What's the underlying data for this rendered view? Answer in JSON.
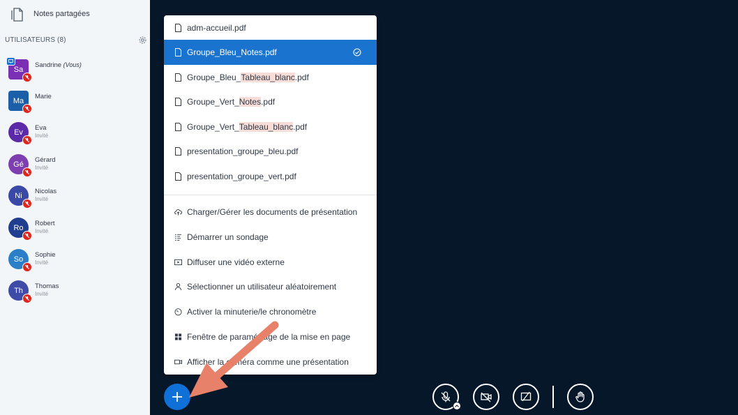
{
  "sidebar": {
    "notes_label": "Notes partagées",
    "users_header": "UTILISATEURS (8)",
    "users": [
      {
        "initials": "Sa",
        "name": "Sandrine",
        "you_tag": "(Vous)",
        "role": "",
        "color": "#7b2fb5"
      },
      {
        "initials": "Ma",
        "name": "Marie",
        "you_tag": "",
        "role": "",
        "color": "#1b5fa8"
      },
      {
        "initials": "Ev",
        "name": "Eva",
        "you_tag": "",
        "role": "Invité",
        "color": "#5b2aa8"
      },
      {
        "initials": "Gé",
        "name": "Gérard",
        "you_tag": "",
        "role": "Invité",
        "color": "#7d3fb0"
      },
      {
        "initials": "Ni",
        "name": "Nicolas",
        "you_tag": "",
        "role": "Invité",
        "color": "#3a49a8"
      },
      {
        "initials": "Ro",
        "name": "Robert",
        "you_tag": "",
        "role": "Invité",
        "color": "#203e8f"
      },
      {
        "initials": "So",
        "name": "Sophie",
        "you_tag": "",
        "role": "Invité",
        "color": "#2a7fc8"
      },
      {
        "initials": "Th",
        "name": "Thomas",
        "you_tag": "",
        "role": "Invité",
        "color": "#3f4ba8"
      }
    ]
  },
  "menu": {
    "files": [
      {
        "label": "adm-accueil.pdf"
      },
      {
        "label": "Groupe_Bleu_Notes.pdf",
        "active": true
      },
      {
        "label_parts": [
          "Groupe_Bleu_",
          "Tableau_blanc",
          ".pdf"
        ]
      },
      {
        "label_parts": [
          "Groupe_Vert_",
          "Notes",
          ".pdf"
        ]
      },
      {
        "label_parts": [
          "Groupe_Vert_",
          "Tableau_blanc",
          ".pdf"
        ]
      },
      {
        "label": "presentation_groupe_bleu.pdf"
      },
      {
        "label": "presentation_groupe_vert.pdf"
      }
    ],
    "actions": [
      {
        "label": "Charger/Gérer les documents de présentation",
        "icon": "upload-cloud-icon"
      },
      {
        "label": "Démarrer un sondage",
        "icon": "poll-icon"
      },
      {
        "label": "Diffuser une vidéo externe",
        "icon": "external-video-icon"
      },
      {
        "label": "Sélectionner un utilisateur aléatoirement",
        "icon": "random-user-icon"
      },
      {
        "label": "Activer la minuterie/le chronomètre",
        "icon": "timer-icon"
      },
      {
        "label_parts": [
          "Fenêtre de paramé",
          "tr",
          "age de la mise en page"
        ],
        "icon": "layout-icon"
      },
      {
        "label_parts": [
          "Afficher la",
          " ca",
          "méra comme une présentation"
        ],
        "icon": "camera-icon"
      }
    ]
  },
  "controls": {
    "actions_button": "plus-icon",
    "buttons": [
      "mic-muted-icon",
      "camera-off-icon",
      "screenshare-off-icon",
      "raise-hand-icon"
    ]
  },
  "colors": {
    "background": "#06172a",
    "sidebar": "#f3f6f9",
    "accent": "#0f70d7",
    "active_row": "#1b73d0",
    "mic_muted": "#df2721",
    "highlight": "#f7ddd8",
    "annotation_arrow": "#e8816a"
  }
}
